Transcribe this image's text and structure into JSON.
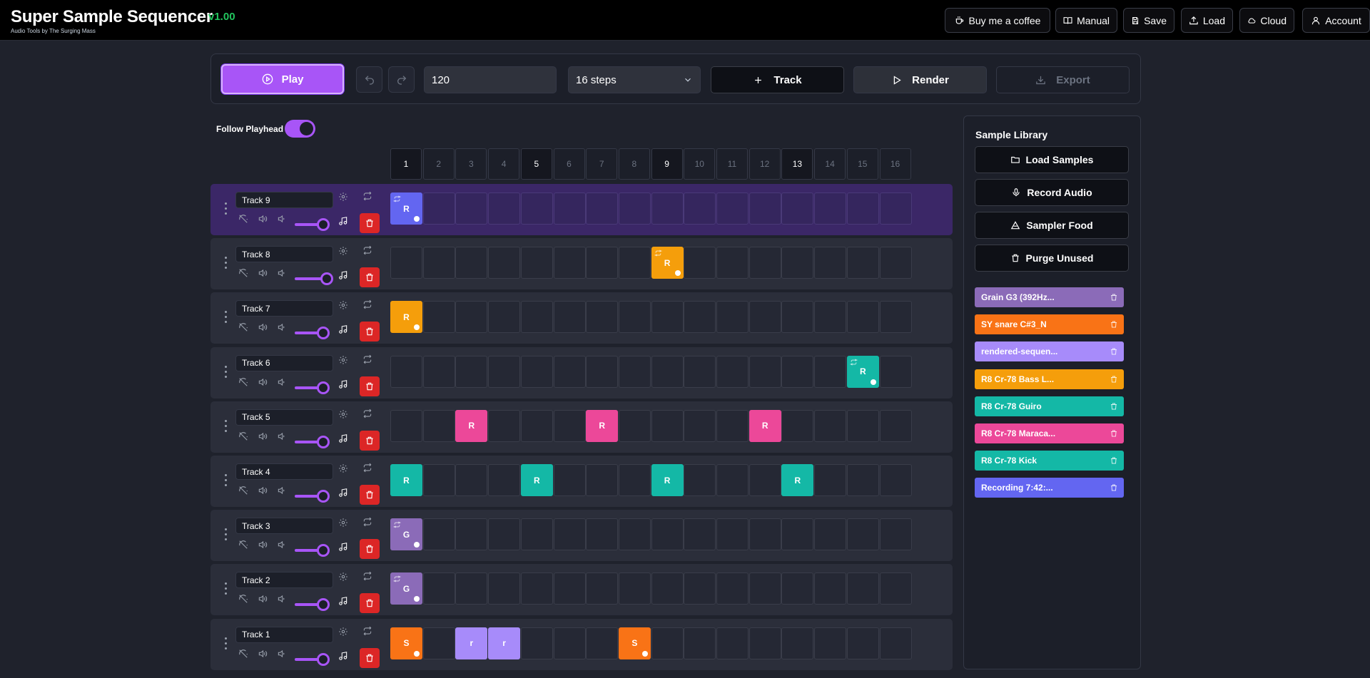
{
  "app": {
    "title": "Super Sample Sequencer",
    "version": "v1.00",
    "subtitle": "Audio Tools by The Surging Mass"
  },
  "header_buttons": [
    {
      "label": "Buy me a coffee",
      "icon": "coffee-icon"
    },
    {
      "label": "Manual",
      "icon": "book-icon"
    },
    {
      "label": "Save",
      "icon": "save-icon"
    },
    {
      "label": "Load",
      "icon": "upload-icon"
    },
    {
      "label": "Cloud",
      "icon": "cloud-icon"
    },
    {
      "label": "Account",
      "icon": "user-icon"
    }
  ],
  "toolbar": {
    "play_label": "Play",
    "bpm_value": "120",
    "steps_value": "16 steps",
    "track_label": "Track",
    "render_label": "Render",
    "export_label": "Export"
  },
  "follow_playhead": {
    "label": "Follow Playhead",
    "enabled": true
  },
  "steps": [
    "1",
    "2",
    "3",
    "4",
    "5",
    "6",
    "7",
    "8",
    "9",
    "10",
    "11",
    "12",
    "13",
    "14",
    "15",
    "16"
  ],
  "accent_steps": [
    1,
    5,
    9,
    13
  ],
  "tracks": [
    {
      "name": "Track 9",
      "active": true,
      "volume": 0.85,
      "notes": [
        {
          "step": 1,
          "label": "R",
          "color": "#6366f1",
          "loop": true,
          "dot": true
        }
      ]
    },
    {
      "name": "Track 8",
      "active": false,
      "volume": 1.0,
      "notes": [
        {
          "step": 9,
          "label": "R",
          "color": "#f59e0b",
          "loop": true,
          "dot": true
        }
      ]
    },
    {
      "name": "Track 7",
      "active": false,
      "volume": 0.85,
      "notes": [
        {
          "step": 1,
          "label": "R",
          "color": "#f59e0b",
          "loop": false,
          "dot": true
        }
      ]
    },
    {
      "name": "Track 6",
      "active": false,
      "volume": 0.85,
      "notes": [
        {
          "step": 15,
          "label": "R",
          "color": "#14b8a6",
          "loop": true,
          "dot": true
        }
      ]
    },
    {
      "name": "Track 5",
      "active": false,
      "volume": 0.85,
      "notes": [
        {
          "step": 3,
          "label": "R",
          "color": "#ec4899",
          "loop": false,
          "dot": false
        },
        {
          "step": 7,
          "label": "R",
          "color": "#ec4899",
          "loop": false,
          "dot": false
        },
        {
          "step": 12,
          "label": "R",
          "color": "#ec4899",
          "loop": false,
          "dot": false
        }
      ]
    },
    {
      "name": "Track 4",
      "active": false,
      "volume": 0.85,
      "notes": [
        {
          "step": 1,
          "label": "R",
          "color": "#14b8a6",
          "loop": false,
          "dot": false
        },
        {
          "step": 5,
          "label": "R",
          "color": "#14b8a6",
          "loop": false,
          "dot": false
        },
        {
          "step": 9,
          "label": "R",
          "color": "#14b8a6",
          "loop": false,
          "dot": false
        },
        {
          "step": 13,
          "label": "R",
          "color": "#14b8a6",
          "loop": false,
          "dot": false
        }
      ]
    },
    {
      "name": "Track 3",
      "active": false,
      "volume": 0.85,
      "notes": [
        {
          "step": 1,
          "label": "G",
          "color": "#8b6bb8",
          "loop": true,
          "dot": true
        }
      ]
    },
    {
      "name": "Track 2",
      "active": false,
      "volume": 0.85,
      "notes": [
        {
          "step": 1,
          "label": "G",
          "color": "#8b6bb8",
          "loop": true,
          "dot": true
        }
      ]
    },
    {
      "name": "Track 1",
      "active": false,
      "volume": 0.85,
      "notes": [
        {
          "step": 1,
          "label": "S",
          "color": "#f97316",
          "loop": false,
          "dot": true
        },
        {
          "step": 3,
          "label": "r",
          "color": "#a78bfa",
          "loop": false,
          "dot": false
        },
        {
          "step": 4,
          "label": "r",
          "color": "#a78bfa",
          "loop": false,
          "dot": false
        },
        {
          "step": 8,
          "label": "S",
          "color": "#f97316",
          "loop": false,
          "dot": true
        }
      ]
    }
  ],
  "library": {
    "title": "Sample Library",
    "buttons": [
      {
        "label": "Load Samples",
        "icon": "folder-icon"
      },
      {
        "label": "Record Audio",
        "icon": "mic-icon"
      },
      {
        "label": "Sampler Food",
        "icon": "food-icon"
      },
      {
        "label": "Purge Unused",
        "icon": "trash-icon"
      }
    ],
    "samples": [
      {
        "label": "Grain G3 (392Hz...",
        "color": "#8b6bb8"
      },
      {
        "label": "SY snare C#3_N",
        "color": "#f97316"
      },
      {
        "label": "rendered-sequen...",
        "color": "#a78bfa"
      },
      {
        "label": "R8 Cr-78 Bass L...",
        "color": "#f59e0b"
      },
      {
        "label": "R8 Cr-78 Guiro",
        "color": "#14b8a6"
      },
      {
        "label": "R8 Cr-78 Maraca...",
        "color": "#ec4899"
      },
      {
        "label": "R8 Cr-78 Kick",
        "color": "#14b8a6"
      },
      {
        "label": "Recording 7:42:...",
        "color": "#6366f1"
      }
    ]
  }
}
